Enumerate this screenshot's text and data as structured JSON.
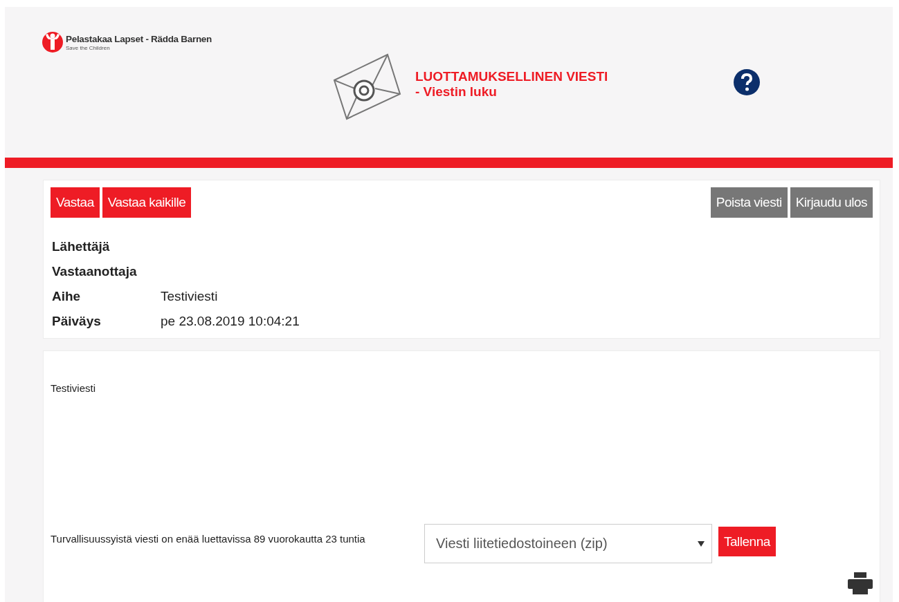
{
  "logo": {
    "name": "Pelastakaa Lapset - Rädda Barnen",
    "tagline": "Save the Children"
  },
  "header": {
    "title": "LUOTTAMUKSELLINEN VIESTI",
    "subtitle": "- Viestin luku"
  },
  "actions": [
    {
      "label": "Vastaa",
      "kind": "primary"
    },
    {
      "label": "Vastaa kaikille",
      "kind": "primary"
    },
    {
      "label": "Poista viesti",
      "kind": "secondary"
    },
    {
      "label": "Kirjaudu ulos",
      "kind": "secondary"
    }
  ],
  "fields": [
    {
      "label": "Lähettäjä"
    },
    {
      "label": "Vastaanottaja"
    },
    {
      "label": "Aihe",
      "value": "Testiviesti"
    },
    {
      "label": "Päiväys",
      "value": "pe 23.08.2019 10:04:21"
    }
  ],
  "message": {
    "body": "Testiviesti",
    "expiry_note": "Turvallisuussyistä viesti on enää luettavissa 89 vuorokautta 23 tuntia",
    "download_select": {
      "value": "Viesti liitetiedostoineen (zip)"
    },
    "save_button": "Tallenna"
  }
}
